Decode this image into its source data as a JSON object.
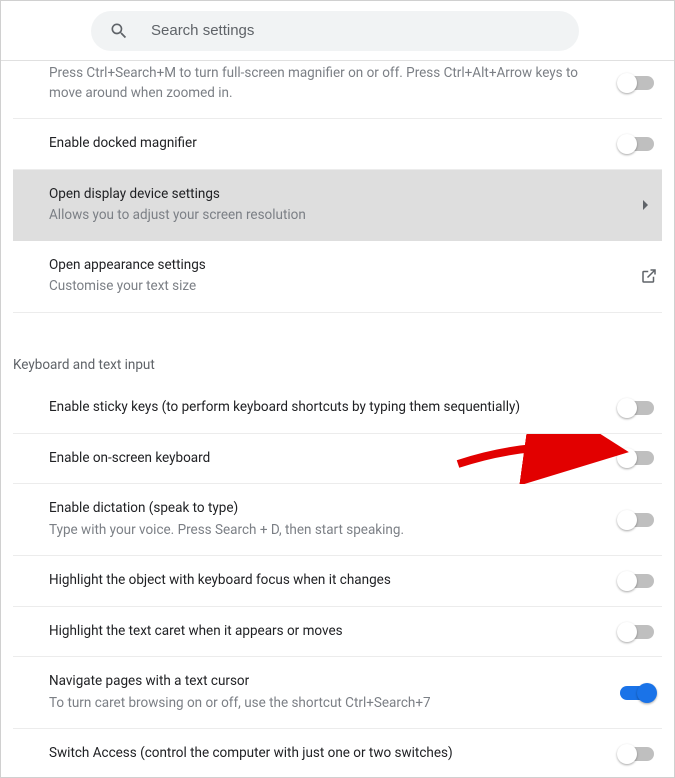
{
  "header": {
    "search_placeholder": "Search settings"
  },
  "display": {
    "fullscreen_mag_sub": "Press Ctrl+Search+M to turn full-screen magnifier on or off. Press Ctrl+Alt+Arrow keys to move around when zoomed in.",
    "docked_mag_title": "Enable docked magnifier",
    "open_display_title": "Open display device settings",
    "open_display_sub": "Allows you to adjust your screen resolution",
    "open_appearance_title": "Open appearance settings",
    "open_appearance_sub": "Customise your text size"
  },
  "keyboard_section_title": "Keyboard and text input",
  "keyboard": {
    "sticky_title": "Enable sticky keys (to perform keyboard shortcuts by typing them sequentially)",
    "osk_title": "Enable on-screen keyboard",
    "dictation_title": "Enable dictation (speak to type)",
    "dictation_sub": "Type with your voice. Press Search + D, then start speaking.",
    "highlight_focus_title": "Highlight the object with keyboard focus when it changes",
    "highlight_caret_title": "Highlight the text caret when it appears or moves",
    "caret_nav_title": "Navigate pages with a text cursor",
    "caret_nav_sub": "To turn caret browsing on or off, use the shortcut Ctrl+Search+7",
    "switch_access_title": "Switch Access (control the computer with just one or two switches)"
  },
  "toggles": {
    "fullscreen_mag": false,
    "docked_mag": false,
    "sticky": false,
    "osk": false,
    "dictation": false,
    "highlight_focus": false,
    "highlight_caret": false,
    "caret_nav": true,
    "switch_access": false
  }
}
